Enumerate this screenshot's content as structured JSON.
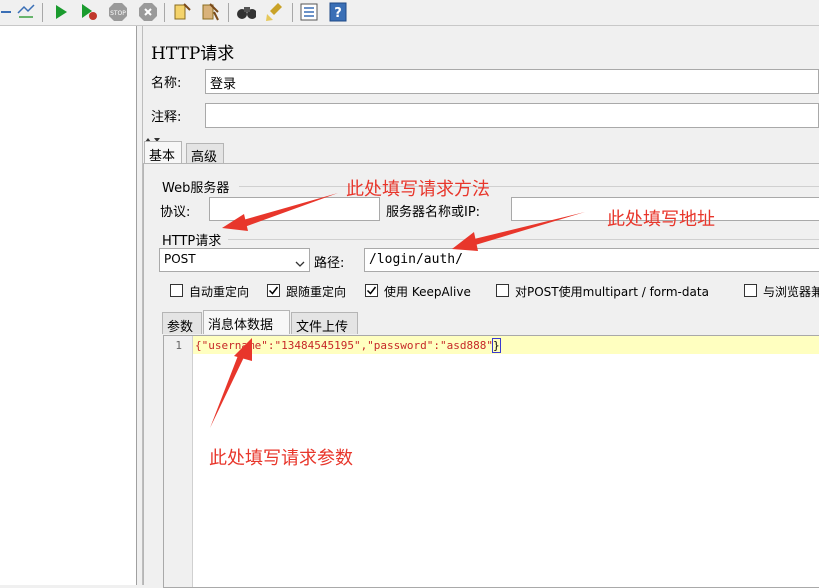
{
  "toolbar": {
    "icons": [
      "arrow-icon",
      "expand-icon",
      "start-icon",
      "start-no-pause-icon",
      "stop-icon",
      "shutdown-icon",
      "clear-icon",
      "clear-all-icon",
      "search-icon",
      "reset-search-icon",
      "function-helper-icon",
      "help-icon"
    ],
    "colors": {
      "start": "#1a9b2e",
      "stop": "#9a9a9a"
    }
  },
  "panel": {
    "title": "HTTP请求",
    "name_label": "名称:",
    "name_value": "登录",
    "comment_label": "注释:",
    "comment_value": "",
    "tabs": [
      {
        "label": "基本",
        "active": true
      },
      {
        "label": "高级",
        "active": false
      }
    ]
  },
  "web_server": {
    "group_label": "Web服务器",
    "protocol_label": "协议:",
    "protocol_value": "",
    "server_label": "服务器名称或IP:",
    "server_value": ""
  },
  "http_request": {
    "group_label": "HTTP请求",
    "method": "POST",
    "path_label": "路径:",
    "path_value": "/login/auth/",
    "checkboxes": [
      {
        "label": "自动重定向",
        "checked": false
      },
      {
        "label": "跟随重定向",
        "checked": true
      },
      {
        "label": "使用 KeepAlive",
        "checked": true
      },
      {
        "label": "对POST使用multipart / form-data",
        "checked": false
      },
      {
        "label": "与浏览器兼",
        "checked": false
      }
    ],
    "body_tabs": [
      {
        "label": "参数",
        "active": false
      },
      {
        "label": "消息体数据",
        "active": true
      },
      {
        "label": "文件上传",
        "active": false
      }
    ]
  },
  "editor": {
    "line_number": "1",
    "text_part1": "{\"username\":\"13484545195\",\"password\":\"asd888\"",
    "text_part2": "}",
    "highlight_color": "#ffffc0"
  },
  "annotations": {
    "method_note": "此处填写请求方法",
    "path_note": "此处填写地址",
    "body_note": "此处填写请求参数",
    "color": "#e8362b"
  }
}
